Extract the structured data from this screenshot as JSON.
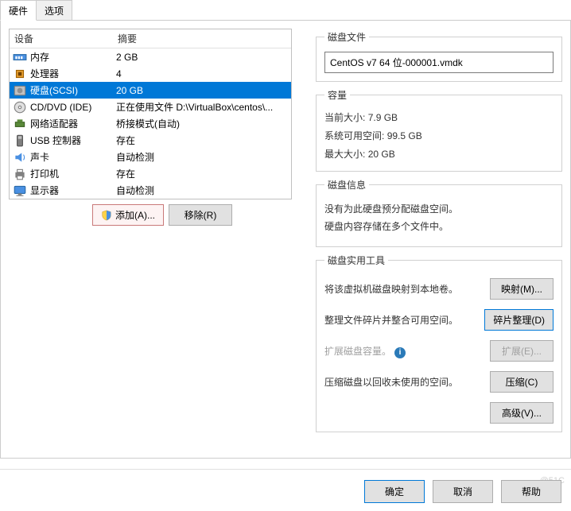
{
  "tabs": {
    "hardware": "硬件",
    "options": "选项"
  },
  "headers": {
    "device": "设备",
    "summary": "摘要"
  },
  "devices": [
    {
      "name": "内存",
      "summary": "2 GB",
      "icon": "memory"
    },
    {
      "name": "处理器",
      "summary": "4",
      "icon": "cpu"
    },
    {
      "name": "硬盘(SCSI)",
      "summary": "20 GB",
      "icon": "disk",
      "selected": true
    },
    {
      "name": "CD/DVD (IDE)",
      "summary": "正在使用文件 D:\\VirtualBox\\centos\\...",
      "icon": "cd"
    },
    {
      "name": "网络适配器",
      "summary": "桥接模式(自动)",
      "icon": "network"
    },
    {
      "name": "USB 控制器",
      "summary": "存在",
      "icon": "usb"
    },
    {
      "name": "声卡",
      "summary": "自动检测",
      "icon": "sound"
    },
    {
      "name": "打印机",
      "summary": "存在",
      "icon": "printer"
    },
    {
      "name": "显示器",
      "summary": "自动检测",
      "icon": "display"
    }
  ],
  "bottom": {
    "add": "添加(A)...",
    "remove": "移除(R)"
  },
  "diskFile": {
    "legend": "磁盘文件",
    "value": "CentOS v7 64 位-000001.vmdk"
  },
  "capacity": {
    "legend": "容量",
    "current_label": "当前大小:",
    "current_value": "7.9 GB",
    "free_label": "系统可用空间:",
    "free_value": "99.5 GB",
    "max_label": "最大大小:",
    "max_value": "20 GB"
  },
  "diskInfo": {
    "legend": "磁盘信息",
    "line1": "没有为此硬盘预分配磁盘空间。",
    "line2": "硬盘内容存储在多个文件中。"
  },
  "utilities": {
    "legend": "磁盘实用工具",
    "map_text": "将该虚拟机磁盘映射到本地卷。",
    "map_btn": "映射(M)...",
    "defrag_text": "整理文件碎片并整合可用空间。",
    "defrag_btn": "碎片整理(D)",
    "expand_text": "扩展磁盘容量。",
    "expand_btn": "扩展(E)...",
    "compact_text": "压缩磁盘以回收未使用的空间。",
    "compact_btn": "压缩(C)",
    "advanced_btn": "高级(V)..."
  },
  "footer": {
    "ok": "确定",
    "cancel": "取消",
    "help": "帮助"
  },
  "watermark": "@51C"
}
